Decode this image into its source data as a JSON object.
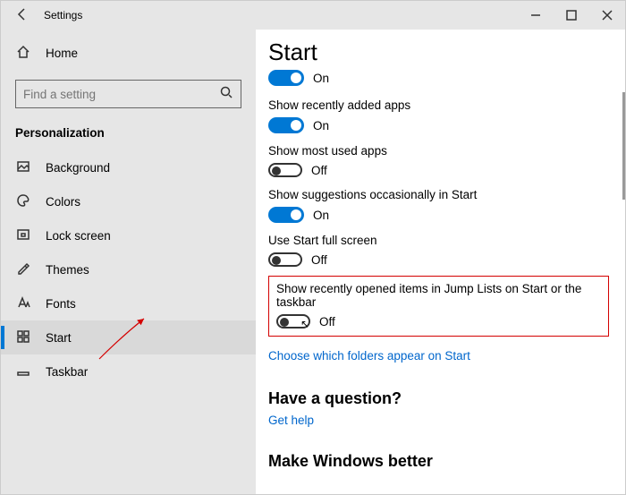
{
  "window": {
    "title": "Settings"
  },
  "sidebar": {
    "home": "Home",
    "search_placeholder": "Find a setting",
    "category": "Personalization",
    "items": [
      {
        "label": "Background"
      },
      {
        "label": "Colors"
      },
      {
        "label": "Lock screen"
      },
      {
        "label": "Themes"
      },
      {
        "label": "Fonts"
      },
      {
        "label": "Start"
      },
      {
        "label": "Taskbar"
      }
    ]
  },
  "main": {
    "title": "Start",
    "partial_toggle": {
      "state": "on",
      "text": "On"
    },
    "settings": [
      {
        "label": "Show recently added apps",
        "state": "on",
        "text": "On"
      },
      {
        "label": "Show most used apps",
        "state": "off",
        "text": "Off"
      },
      {
        "label": "Show suggestions occasionally in Start",
        "state": "on",
        "text": "On"
      },
      {
        "label": "Use Start full screen",
        "state": "off",
        "text": "Off"
      }
    ],
    "highlighted": {
      "label": "Show recently opened items in Jump Lists on Start or the taskbar",
      "state": "off",
      "text": "Off"
    },
    "link": "Choose which folders appear on Start",
    "question_heading": "Have a question?",
    "help_link": "Get help",
    "better_heading": "Make Windows better"
  }
}
